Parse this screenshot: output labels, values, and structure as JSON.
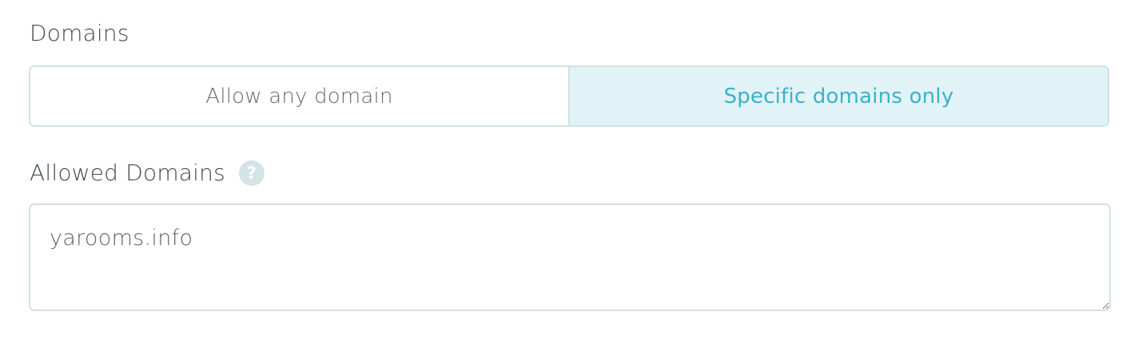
{
  "domains": {
    "label": "Domains",
    "options": [
      {
        "label": "Allow any domain",
        "selected": false
      },
      {
        "label": "Specific domains only",
        "selected": true
      }
    ]
  },
  "allowed_domains": {
    "label": "Allowed Domains",
    "help_icon": "question-circle-icon",
    "help_glyph": "?",
    "value": "yarooms.info"
  },
  "colors": {
    "accent": "#3ab2c9",
    "selected_bg": "#e2f3f7",
    "border": "#d1e2e5",
    "text": "#3f4a50"
  }
}
